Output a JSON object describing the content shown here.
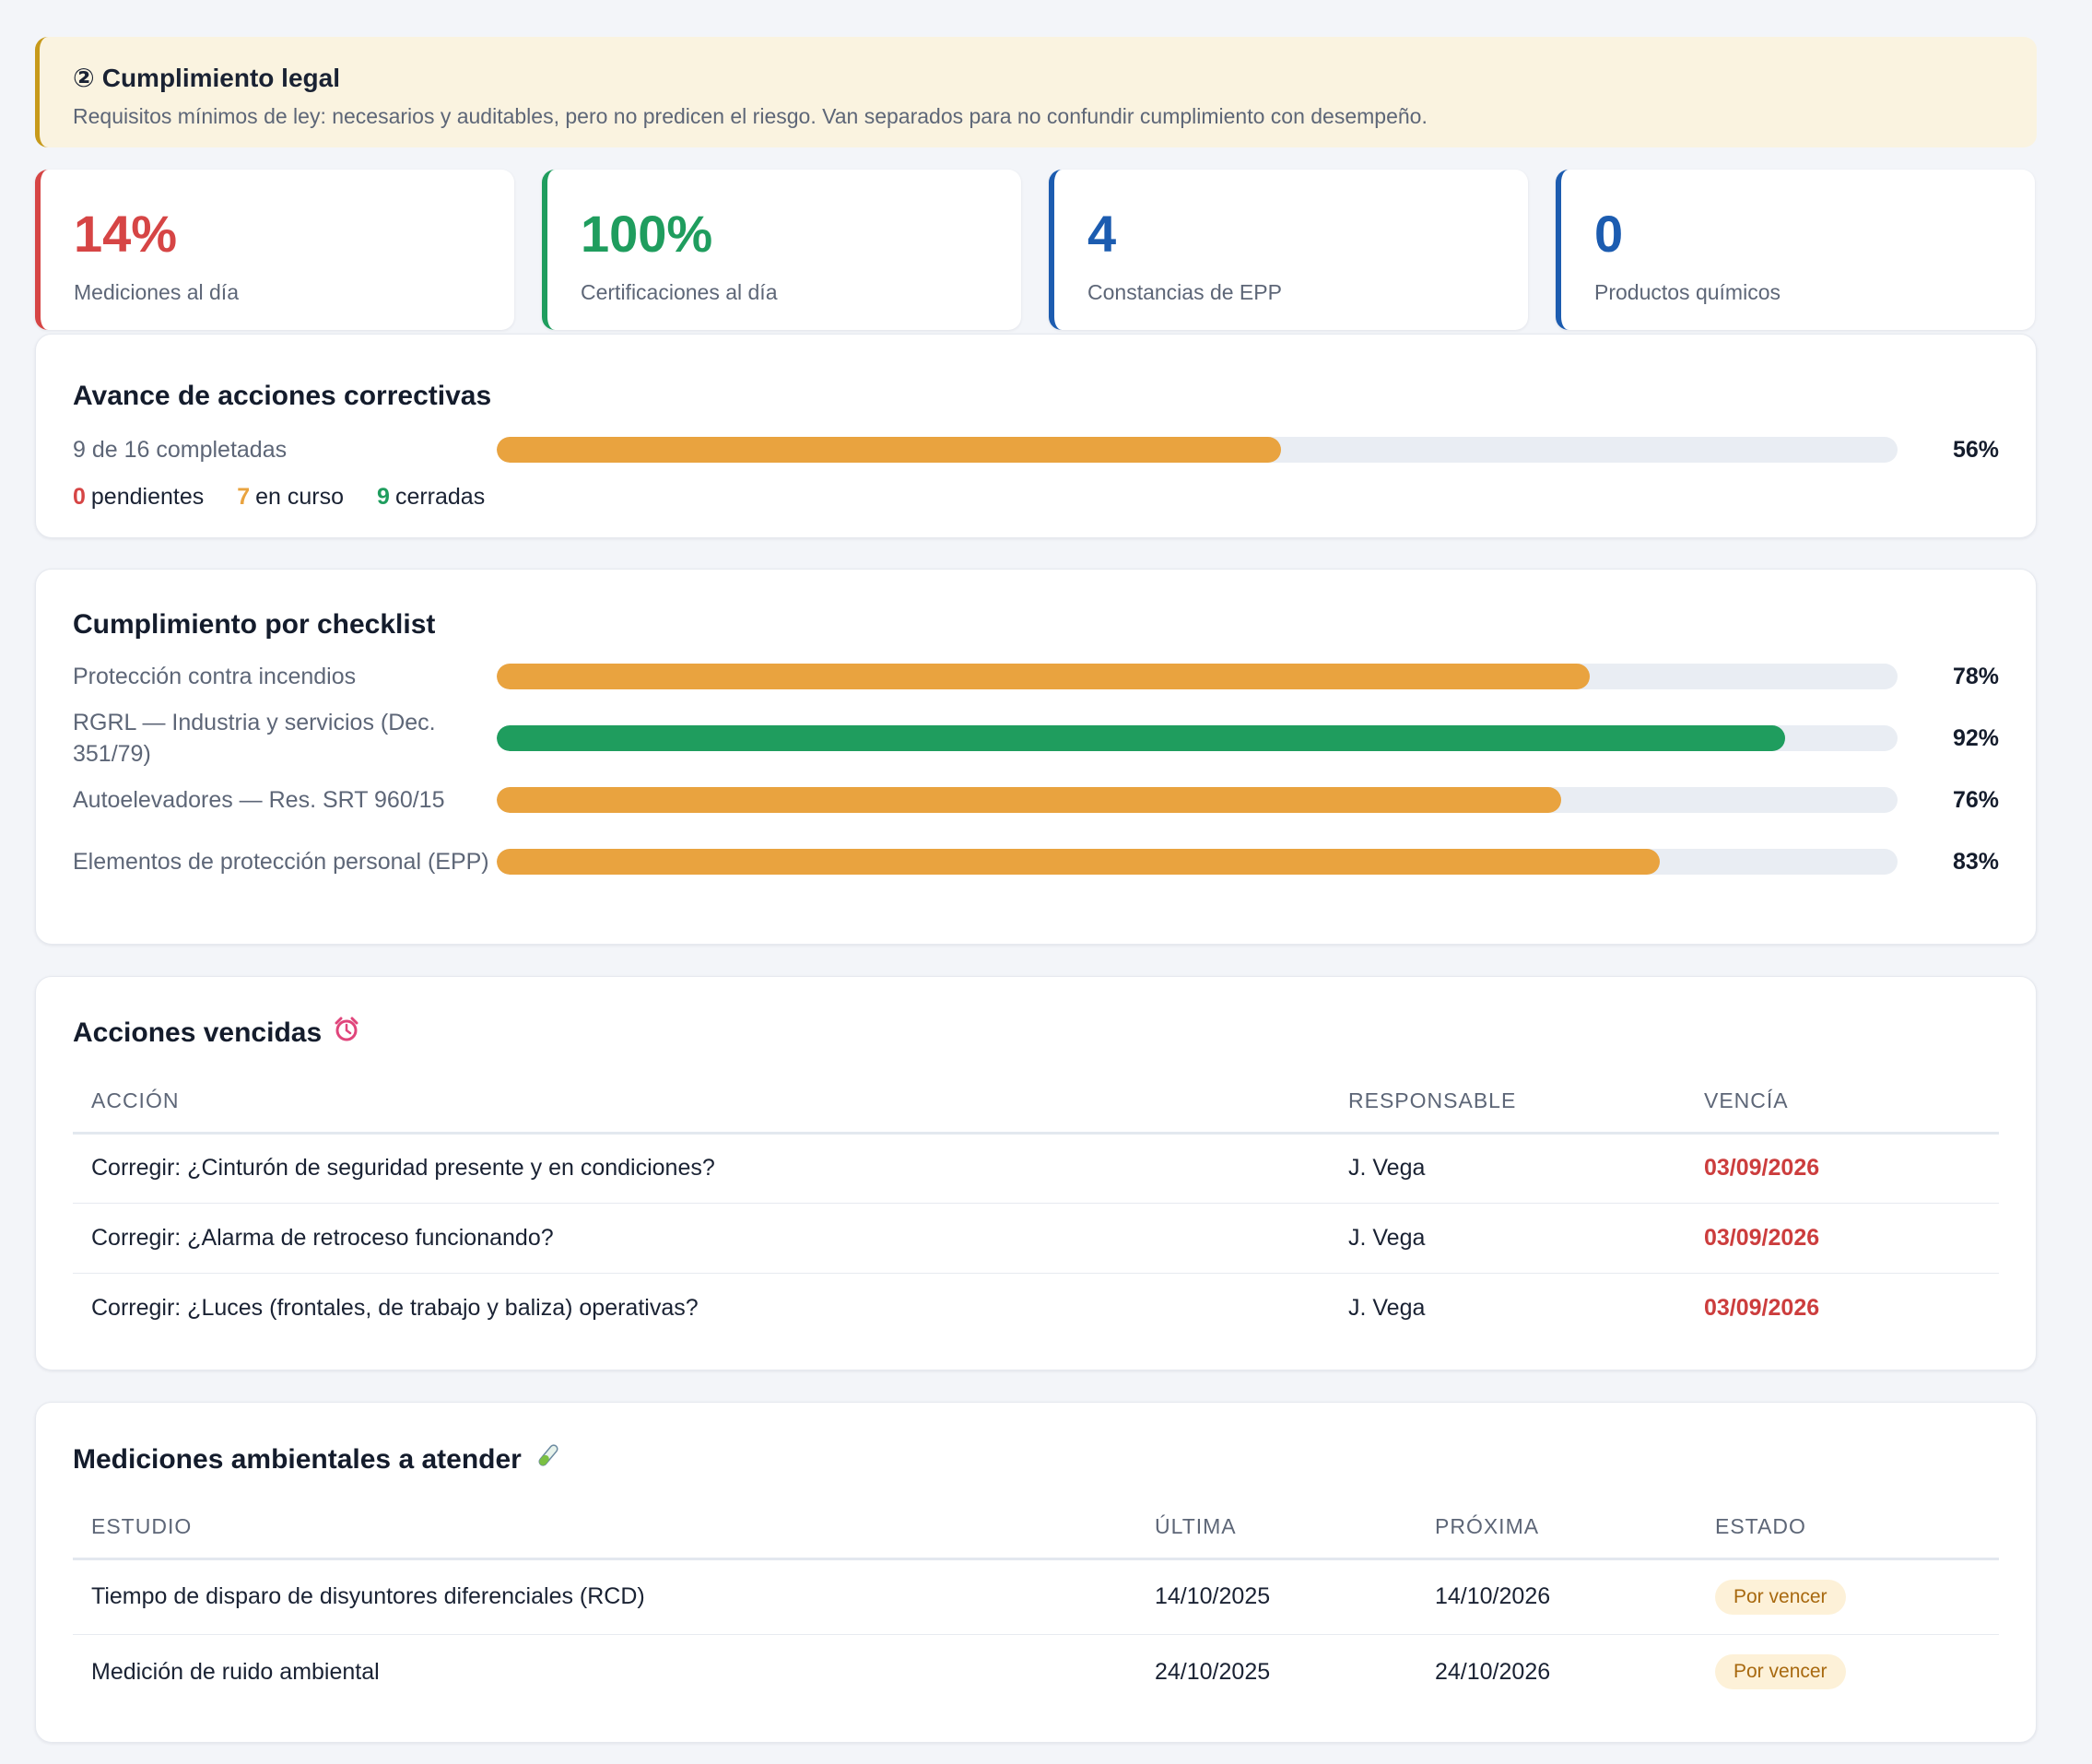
{
  "banner": {
    "number": "②",
    "title": "Cumplimiento legal",
    "description": "Requisitos mínimos de ley: necesarios y auditables, pero no predicen el riesgo. Van separados para no confundir cumplimiento con desempeño."
  },
  "kpis": [
    {
      "value": "14%",
      "label": "Mediciones al día",
      "color": "#d64545"
    },
    {
      "value": "100%",
      "label": "Certificaciones al día",
      "color": "#1f9d5e"
    },
    {
      "value": "4",
      "label": "Constancias de EPP",
      "color": "#1c5cb0"
    },
    {
      "value": "0",
      "label": "Productos químicos",
      "color": "#1c5cb0"
    }
  ],
  "corrective": {
    "title": "Avance de acciones correctivas",
    "summary": "9 de 16 completadas",
    "percent": 56,
    "percent_label": "56%",
    "bar_color": "#e9a33f",
    "pending_count": "0",
    "pending_label": "pendientes",
    "in_progress_count": "7",
    "in_progress_label": "en curso",
    "closed_count": "9",
    "closed_label": "cerradas",
    "colors": {
      "pending": "#d64545",
      "in_progress": "#e9a33f",
      "closed": "#1f9d5e"
    }
  },
  "checklist": {
    "title": "Cumplimiento por checklist",
    "items": [
      {
        "label": "Protección contra incendios",
        "percent": 78,
        "percent_label": "78%",
        "color": "#e9a33f"
      },
      {
        "label": "RGRL — Industria y servicios (Dec. 351/79)",
        "percent": 92,
        "percent_label": "92%",
        "color": "#1f9d5e"
      },
      {
        "label": "Autoelevadores — Res. SRT 960/15",
        "percent": 76,
        "percent_label": "76%",
        "color": "#e9a33f"
      },
      {
        "label": "Elementos de protección personal (EPP)",
        "percent": 83,
        "percent_label": "83%",
        "color": "#e9a33f"
      }
    ]
  },
  "overdue": {
    "title": "Acciones vencidas",
    "icon": "alarm-clock-icon",
    "columns": [
      "ACCIÓN",
      "RESPONSABLE",
      "VENCÍA"
    ],
    "rows": [
      {
        "action": "Corregir: ¿Cinturón de seguridad presente y en condiciones?",
        "owner": "J. Vega",
        "due": "03/09/2026"
      },
      {
        "action": "Corregir: ¿Alarma de retroceso funcionando?",
        "owner": "J. Vega",
        "due": "03/09/2026"
      },
      {
        "action": "Corregir: ¿Luces (frontales, de trabajo y baliza) operativas?",
        "owner": "J. Vega",
        "due": "03/09/2026"
      }
    ]
  },
  "measurements": {
    "title": "Mediciones ambientales a atender",
    "icon": "test-tube-icon",
    "columns": [
      "ESTUDIO",
      "ÚLTIMA",
      "PRÓXIMA",
      "ESTADO"
    ],
    "rows": [
      {
        "study": "Tiempo de disparo de disyuntores diferenciales (RCD)",
        "last": "14/10/2025",
        "next": "14/10/2026",
        "status": "Por vencer"
      },
      {
        "study": "Medición de ruido ambiental",
        "last": "24/10/2025",
        "next": "24/10/2026",
        "status": "Por vencer"
      }
    ]
  }
}
